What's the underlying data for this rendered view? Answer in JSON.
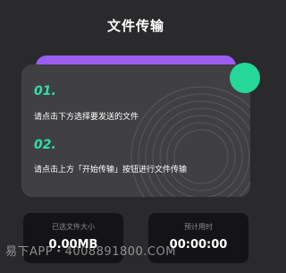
{
  "header": {
    "title": "文件传输"
  },
  "steps": [
    {
      "num": "01.",
      "text": "请点击下方选择要发送的文件"
    },
    {
      "num": "02.",
      "text": "请点击上方「开始传输」按钮进行文件传输"
    }
  ],
  "stats": {
    "selected_size_label": "已选文件大小",
    "selected_size_value": "0.00MB",
    "eta_label": "预计用时",
    "eta_value": "00:00:00"
  },
  "watermark": "易下APP・4008891800.COM",
  "colors": {
    "background": "#2a2a2c",
    "card": "#404043",
    "accent_green": "#2fe0a8",
    "accent_purple": "#9b5cf0",
    "stat_box": "#141416"
  }
}
